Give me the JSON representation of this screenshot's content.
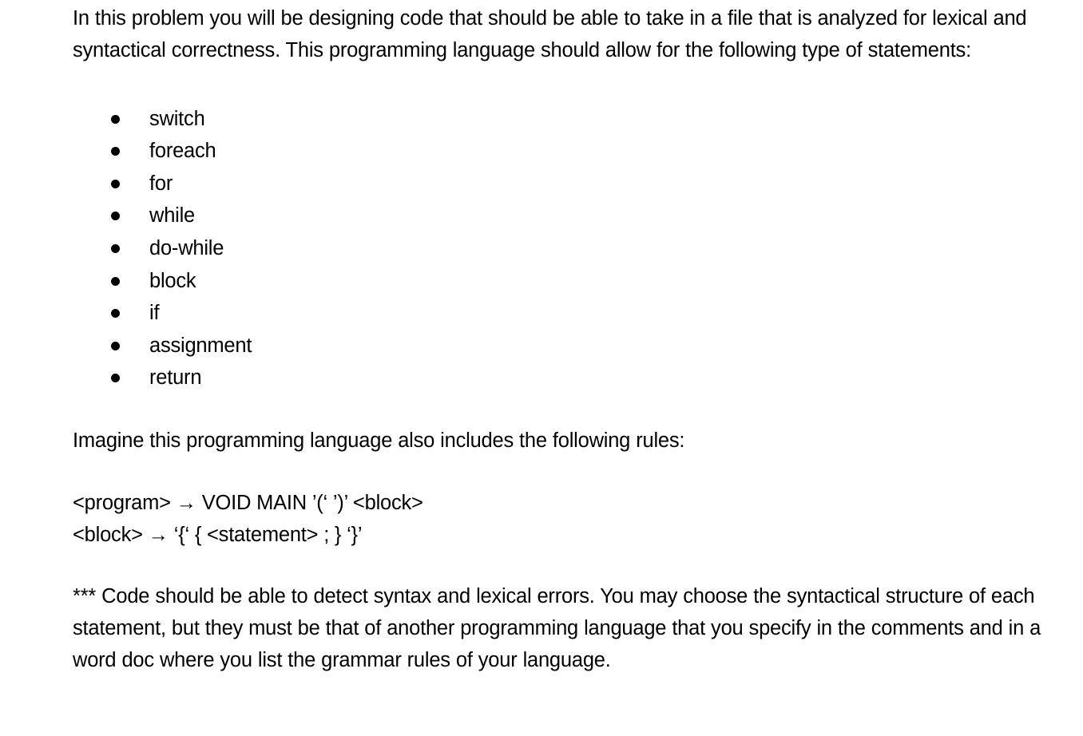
{
  "document": {
    "intro_paragraph": "In this problem you will be designing code that should be able to take in a file that is analyzed for lexical and syntactical correctness. This programming language should allow for the following type of statements:",
    "statement_list": [
      "switch",
      "foreach",
      "for",
      "while",
      "do-while",
      "block",
      "if",
      "assignment",
      "return"
    ],
    "rules_intro": "Imagine this programming language also includes the following rules:",
    "grammar_rules": [
      "<program> → VOID MAIN ’(‘ ’)’ <block>",
      "<block> → ‘{‘ { <statement> ; } ‘}’"
    ],
    "note_paragraph": "*** Code should be able to detect syntax and lexical errors. You may choose the syntactical structure of each statement, but they must be that of another programming language that you specify in the comments and in a word doc where you list the grammar rules of your language.",
    "colors": {
      "text": "#000000",
      "background": "#ffffff"
    }
  }
}
